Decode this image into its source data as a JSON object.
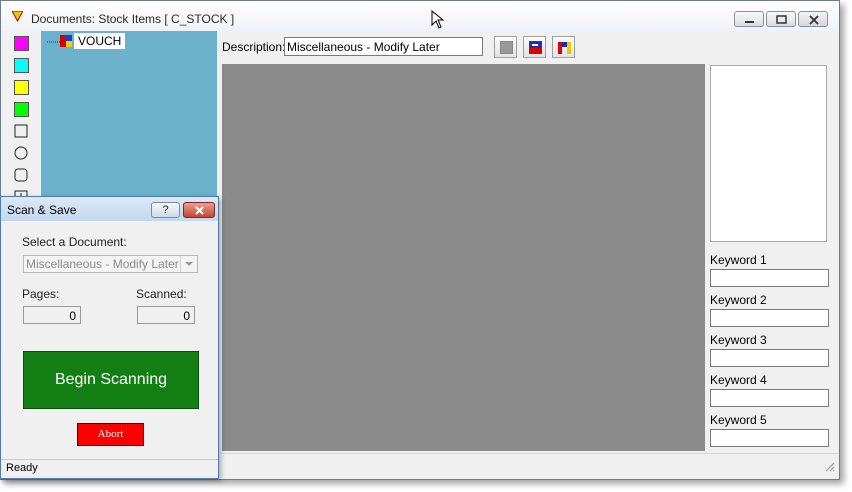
{
  "window": {
    "title": "Documents: Stock Items [ C_STOCK ]"
  },
  "palette": {
    "swatches": [
      "#ff00ff",
      "#00ffff",
      "#ffff00",
      "#00ff00"
    ],
    "shapes": [
      "square-outline-icon",
      "circle-outline-icon",
      "rounded-square-icon",
      "plus-box-icon"
    ]
  },
  "tree": {
    "root_label": "VOUCH"
  },
  "description": {
    "label": "Description:",
    "value": "Miscellaneous - Modify Later"
  },
  "toolbar_icons": [
    "gray-square-icon",
    "flag-icon",
    "color-bars-icon"
  ],
  "keywords": [
    {
      "label": "Keyword 1",
      "value": ""
    },
    {
      "label": "Keyword 2",
      "value": ""
    },
    {
      "label": "Keyword 3",
      "value": ""
    },
    {
      "label": "Keyword 4",
      "value": ""
    },
    {
      "label": "Keyword 5",
      "value": ""
    }
  ],
  "dialog": {
    "title": "Scan & Save",
    "help_label": "?",
    "select_label": "Select a Document:",
    "select_value": "Miscellaneous - Modify Later",
    "pages_label": "Pages:",
    "pages_value": "0",
    "scanned_label": "Scanned:",
    "scanned_value": "0",
    "begin_label": "Begin Scanning",
    "abort_label": "Abort",
    "status": "Ready"
  },
  "colors": {
    "scan_green": "#137e13",
    "abort_red": "#fa0000",
    "tree_bg": "#6cb2cc",
    "viewer_gray": "#8a8a8a"
  }
}
